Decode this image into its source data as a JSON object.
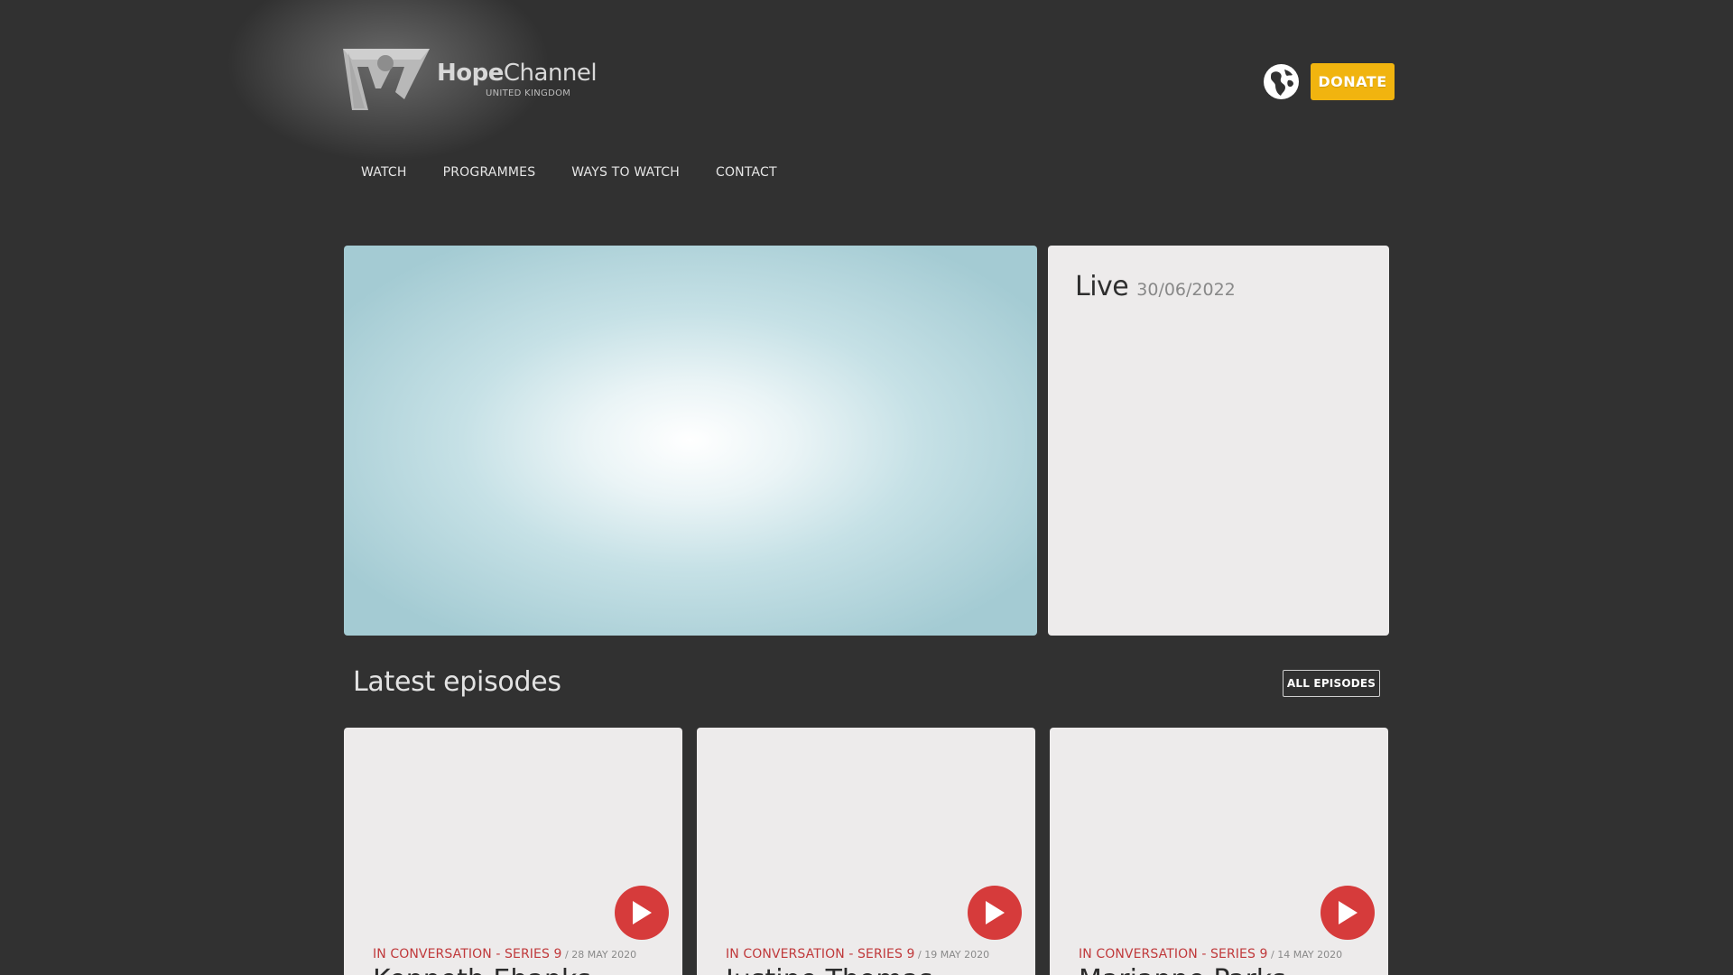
{
  "header": {
    "logo_bold": "Hope",
    "logo_light": "Channel",
    "logo_sub": "UNITED KINGDOM",
    "donate_label": "DONATE",
    "globe_icon": "globe-icon",
    "donate_color": "#f1b40f"
  },
  "nav": {
    "items": [
      {
        "label": "WATCH"
      },
      {
        "label": "PROGRAMMES"
      },
      {
        "label": "WAYS TO WATCH"
      },
      {
        "label": "CONTACT"
      }
    ]
  },
  "live": {
    "title": "Live",
    "date": "30/06/2022"
  },
  "latest": {
    "title": "Latest episodes",
    "all_label": "ALL EPISODES"
  },
  "episodes": [
    {
      "series": "IN CONVERSATION - SERIES 9",
      "date": " / 28 MAY 2020",
      "title": "Kenneth Ebanks"
    },
    {
      "series": "IN CONVERSATION - SERIES 9",
      "date": " / 19 MAY 2020",
      "title": "Justine Thomas"
    },
    {
      "series": "IN CONVERSATION - SERIES 9",
      "date": " / 14 MAY 2020",
      "title": "Marianne Parks"
    }
  ],
  "colors": {
    "background": "#313131",
    "accent_red": "#d63b3b",
    "series_red": "#c0393b"
  }
}
